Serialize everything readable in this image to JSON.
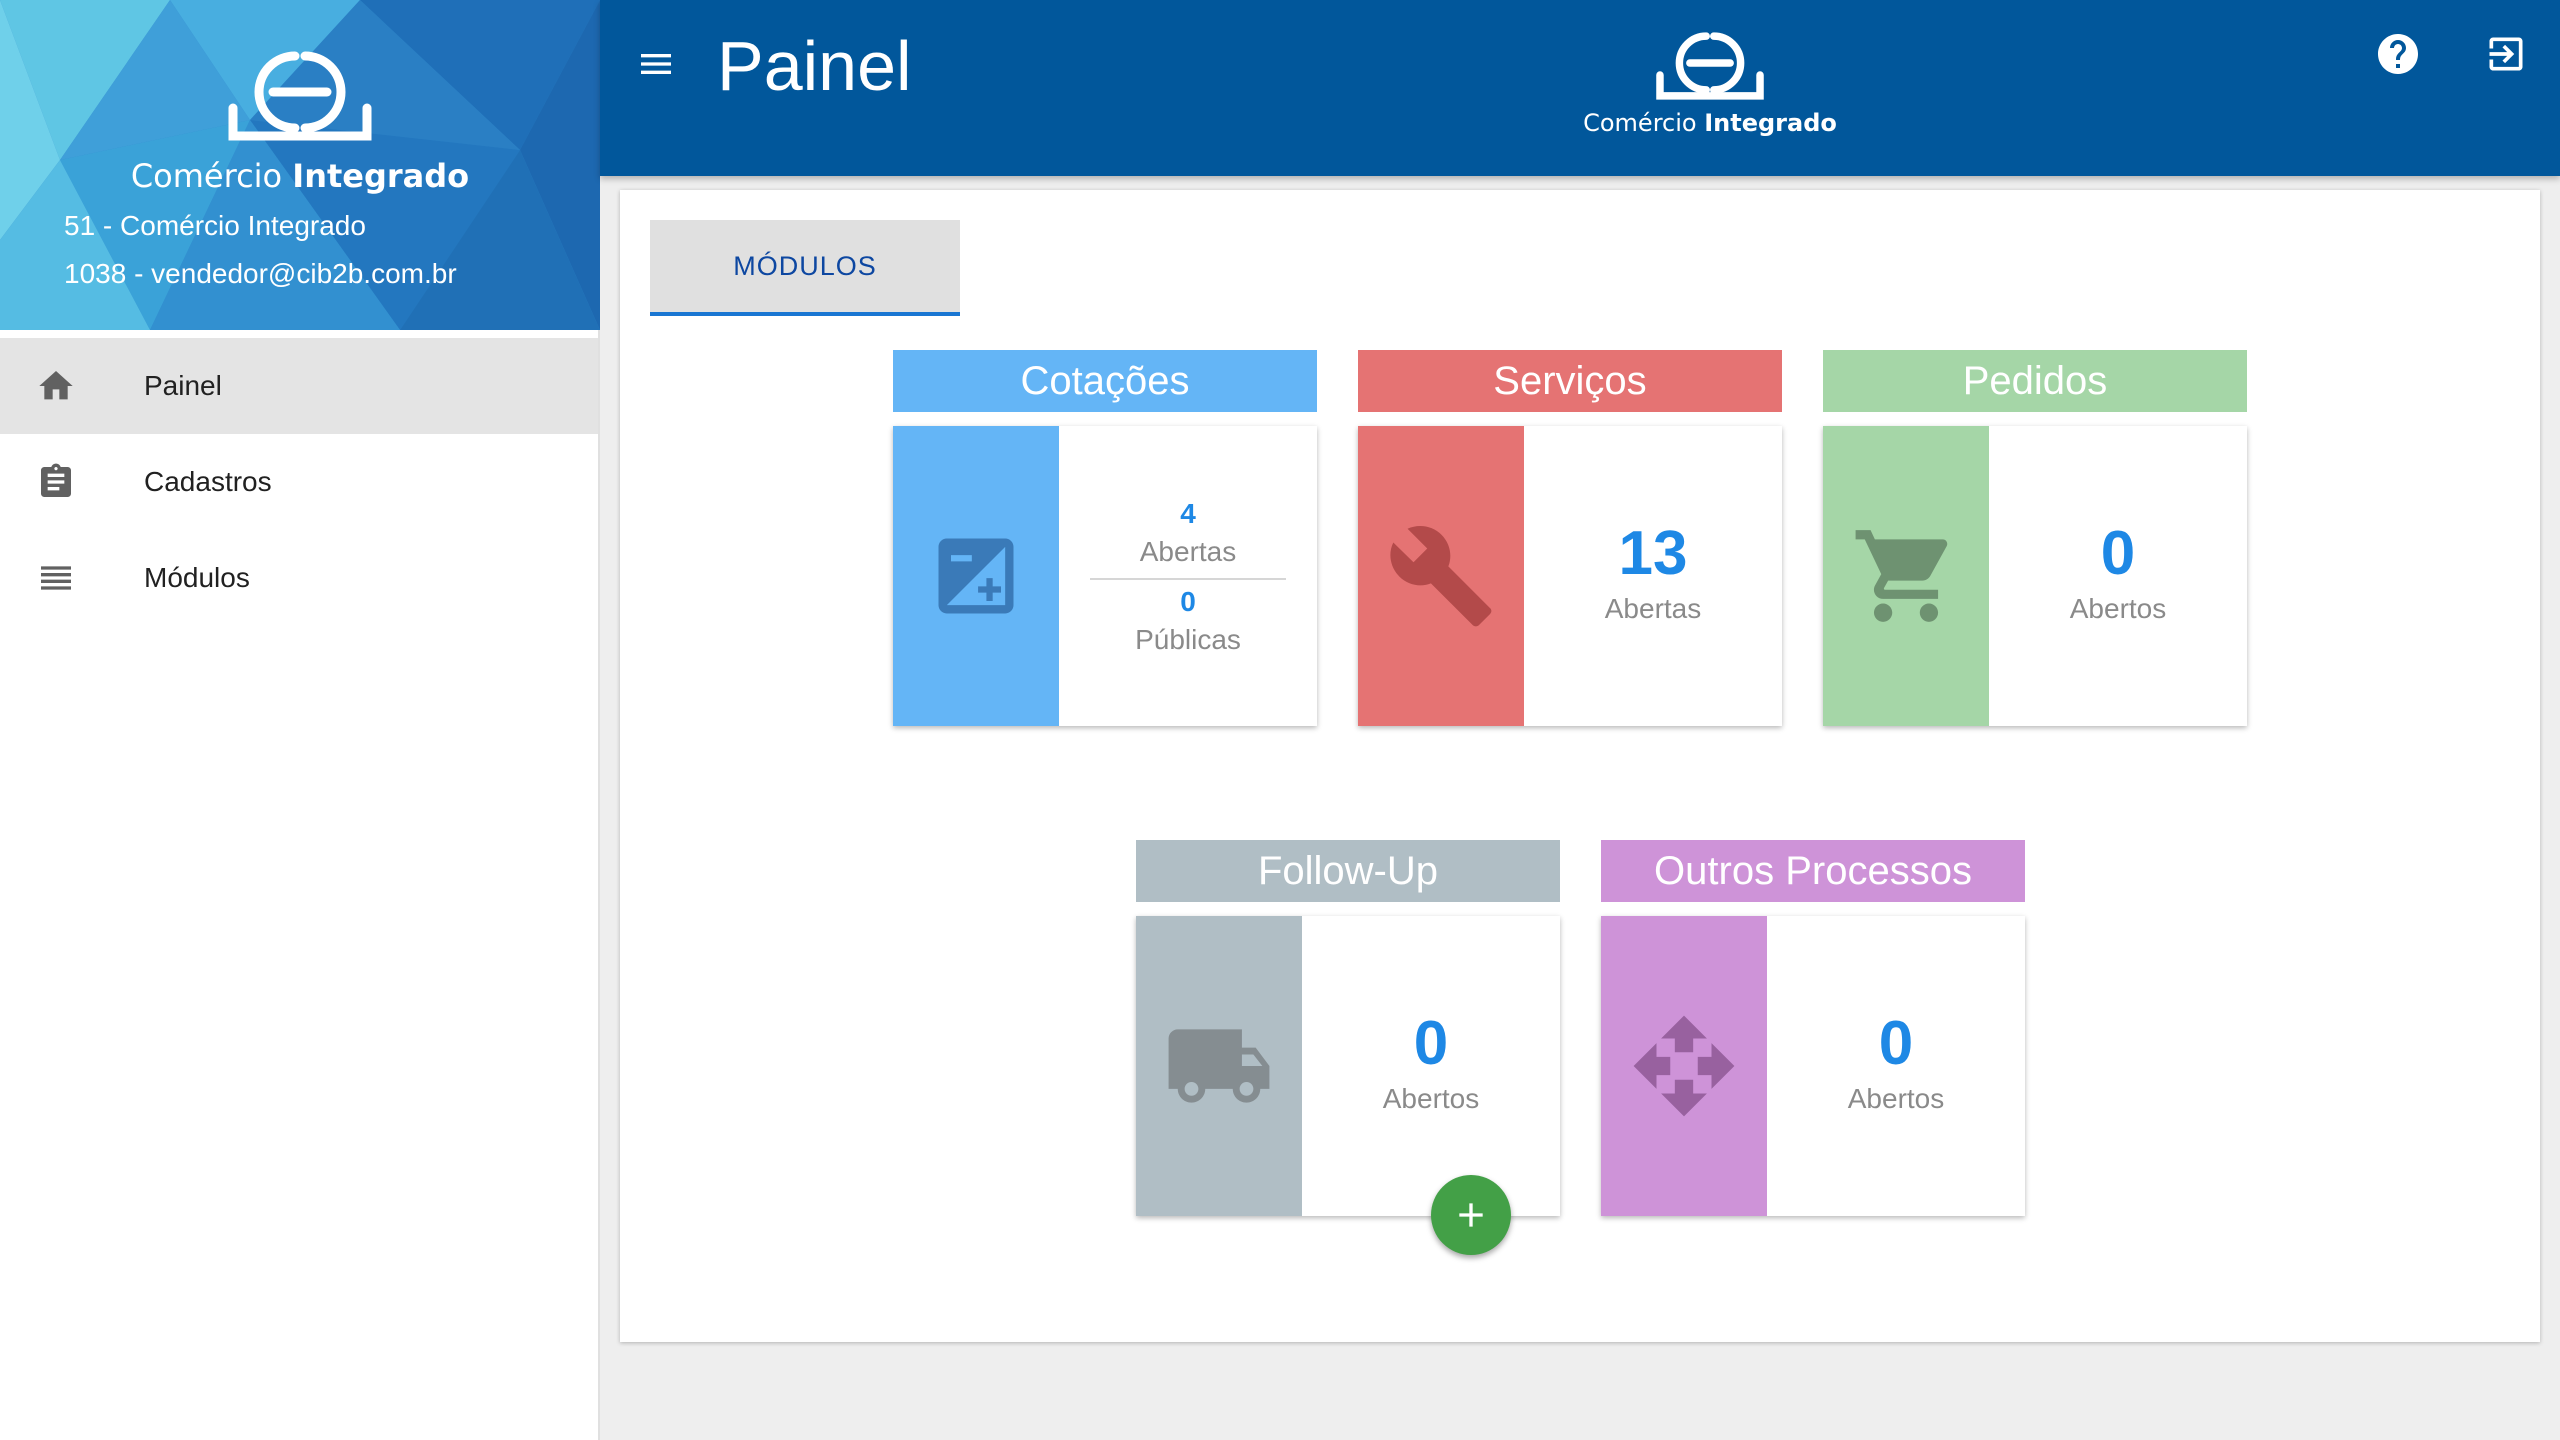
{
  "sidebar": {
    "brand_prefix": "Comércio ",
    "brand_bold": "Integrado",
    "company_line": "51 - Comércio Integrado",
    "user_line": "1038 - vendedor@cib2b.com.br",
    "items": [
      {
        "label": "Painel",
        "icon": "home-icon",
        "active": true
      },
      {
        "label": "Cadastros",
        "icon": "clipboard-icon",
        "active": false
      },
      {
        "label": "Módulos",
        "icon": "list-icon",
        "active": false
      }
    ]
  },
  "topbar": {
    "title": "Painel",
    "brand_prefix": "Comércio ",
    "brand_bold": "Integrado",
    "icons": [
      "menu-icon",
      "help-icon",
      "logout-icon"
    ]
  },
  "tabs": [
    {
      "label": "MÓDULOS",
      "active": true
    }
  ],
  "modules": {
    "cotacoes": {
      "title": "Cotações",
      "color": "#64b5f6",
      "icon": "image-edit-icon",
      "abertas_value": "4",
      "abertas_label": "Abertas",
      "publicas_value": "0",
      "publicas_label": "Públicas"
    },
    "servicos": {
      "title": "Serviços",
      "color": "#e57373",
      "icon": "wrench-icon",
      "value": "13",
      "label": "Abertas"
    },
    "pedidos": {
      "title": "Pedidos",
      "color": "#a5d6a7",
      "icon": "cart-icon",
      "value": "0",
      "label": "Abertos"
    },
    "followup": {
      "title": "Follow-Up",
      "color": "#b0bec5",
      "icon": "truck-icon",
      "value": "0",
      "label": "Abertos"
    },
    "outros": {
      "title": "Outros Processos",
      "color": "#ce93d8",
      "icon": "move-arrows-icon",
      "value": "0",
      "label": "Abertos"
    }
  },
  "colors": {
    "primary": "#01579b",
    "number": "#1e88e5",
    "fab": "#43a047"
  }
}
